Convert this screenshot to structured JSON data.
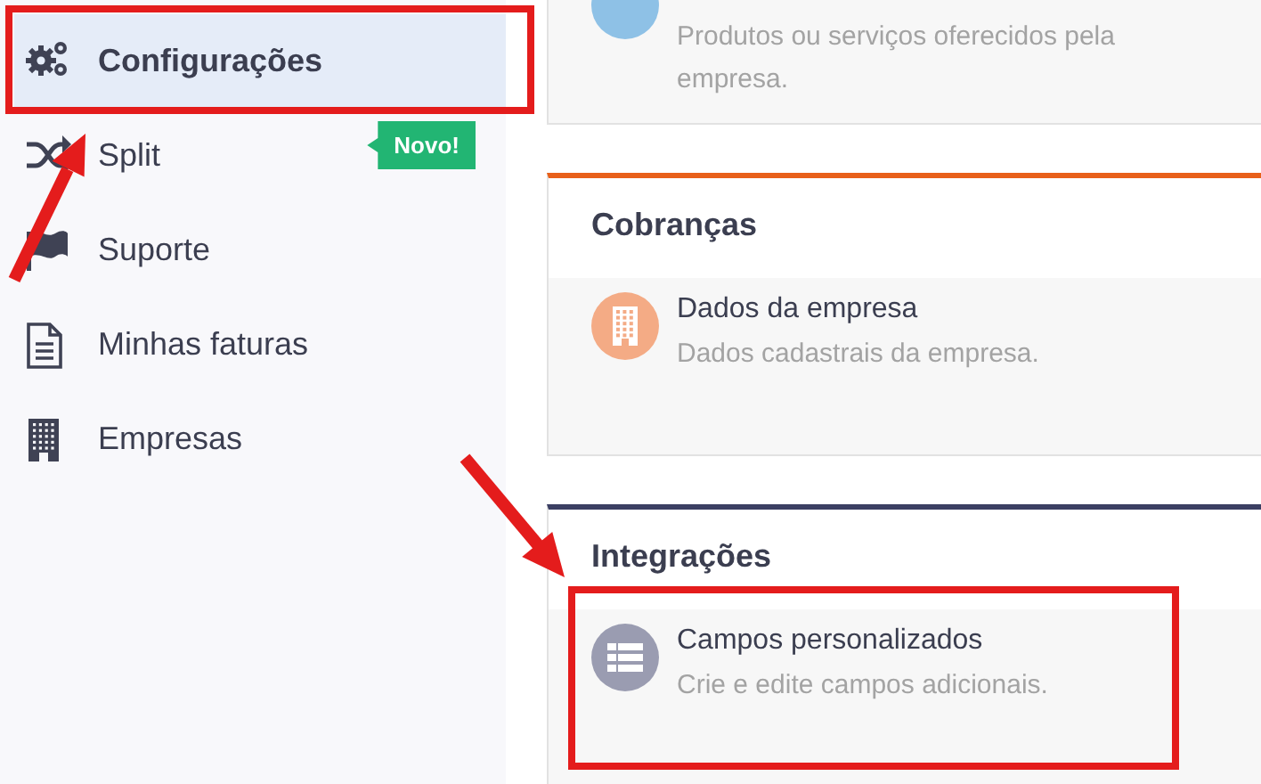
{
  "sidebar": {
    "items": [
      {
        "label": "Configurações",
        "selected": true,
        "highlighted": true
      },
      {
        "label": "Split",
        "selected": false,
        "highlighted": false,
        "badge": "Novo!"
      },
      {
        "label": "Suporte",
        "selected": false,
        "highlighted": false
      },
      {
        "label": "Minhas faturas",
        "selected": false,
        "highlighted": false
      },
      {
        "label": "Empresas",
        "selected": false,
        "highlighted": false
      }
    ]
  },
  "cards": [
    {
      "items": [
        {
          "color": "#8ec1e6",
          "description": "Produtos ou serviços oferecidos pela empresa.",
          "highlighted": false
        }
      ]
    },
    {
      "title": "Cobranças",
      "color": "#e8601a",
      "items": [
        {
          "color": "#f4ab85",
          "title": "Dados da empresa",
          "description": "Dados cadastrais da empresa.",
          "highlighted": false
        }
      ]
    },
    {
      "title": "Integrações",
      "color": "#3b3f63",
      "items": [
        {
          "color": "#9a9cb1",
          "title": "Campos personalizados",
          "description": "Crie e edite campos adicionais.",
          "highlighted": true
        }
      ]
    }
  ]
}
